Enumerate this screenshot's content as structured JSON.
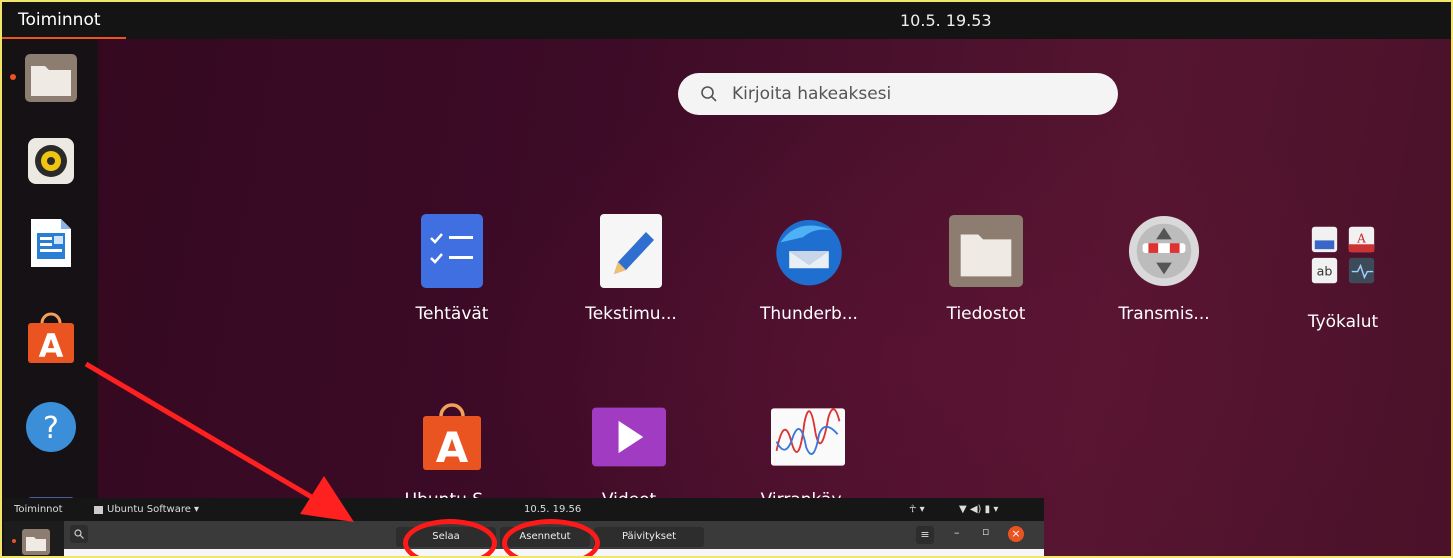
{
  "topbar": {
    "activities": "Toiminnot",
    "clock": "10.5. 19.53"
  },
  "search": {
    "placeholder": "Kirjoita hakeaksesi",
    "icon": "search-icon"
  },
  "dock": {
    "items": [
      {
        "name": "files",
        "icon": "folder-icon",
        "running": true
      },
      {
        "name": "rhythmbox",
        "icon": "speaker-icon"
      },
      {
        "name": "libreoffice-writer",
        "icon": "document-icon"
      },
      {
        "name": "ubuntu-software",
        "icon": "shopping-bag-icon"
      },
      {
        "name": "help",
        "icon": "help-icon"
      },
      {
        "name": "show-apps",
        "icon": "grid-icon"
      }
    ]
  },
  "apps": [
    {
      "label": "Tehtävät",
      "icon": "checklist-icon"
    },
    {
      "label": "Tekstimu...",
      "icon": "text-editor-icon"
    },
    {
      "label": "Thunderb...",
      "icon": "thunderbird-icon"
    },
    {
      "label": "Tiedostot",
      "icon": "folder-icon"
    },
    {
      "label": "Transmis...",
      "icon": "transmission-icon"
    },
    {
      "label": "Työkalut",
      "icon": "folder-grid-icon"
    },
    {
      "label": "Ubuntu S...",
      "icon": "shopping-bag-icon"
    },
    {
      "label": "Videot",
      "icon": "video-play-icon"
    },
    {
      "label": "Virrankäy...",
      "icon": "power-statistics-icon"
    }
  ],
  "inset": {
    "activities": "Toiminnot",
    "app_menu": "Ubuntu Software ▾",
    "clock": "10.5. 19.56",
    "tabs": [
      "Selaa",
      "Asennetut",
      "Päivitykset"
    ],
    "menu_icon": "≡",
    "minimize": "–",
    "maximize": "▫",
    "close": "×"
  },
  "annotations": {
    "arrow_color": "#ff2020",
    "circle_color": "#ff1a1a"
  },
  "colors": {
    "accent": "#e95420",
    "highlight_border": "#f3e46a"
  }
}
